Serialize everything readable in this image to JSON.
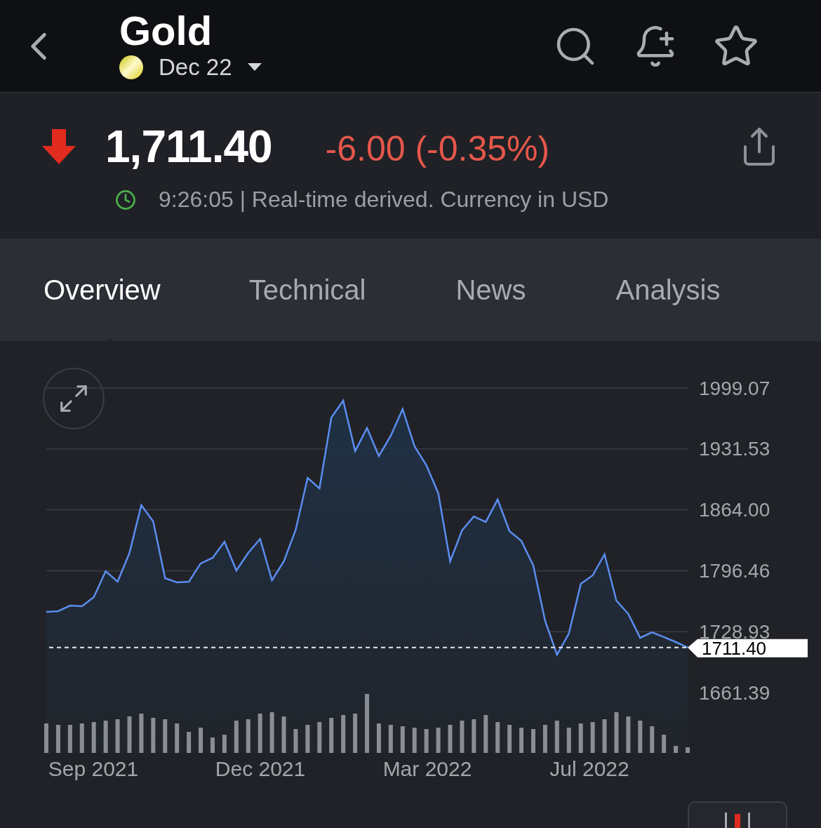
{
  "header": {
    "title": "Gold",
    "contract": "Dec 22"
  },
  "quote": {
    "price": "1,711.40",
    "change": "-6.00 (-0.35%)",
    "falling": true,
    "timestamp": "9:26:05 | Real-time derived. Currency in USD"
  },
  "tabs": [
    {
      "label": "Overview",
      "selected": true
    },
    {
      "label": "Technical",
      "selected": false
    },
    {
      "label": "News",
      "selected": false
    },
    {
      "label": "Analysis",
      "selected": false
    }
  ],
  "chart": {
    "x_labels": [
      "Sep 2021",
      "Dec 2021",
      "Mar 2022",
      "Jul 2022"
    ],
    "chart_data": {
      "type": "area",
      "grid": true,
      "ref_lines": [
        {
          "axis": "y",
          "value": 1711.4,
          "label": "1711.40",
          "color": "#e8e8e8"
        }
      ],
      "ylim": [
        1661.39,
        1999.07
      ],
      "yticks": [
        {
          "value": 1999.07,
          "label": "1999.07"
        },
        {
          "value": 1931.53,
          "label": "1931.53"
        },
        {
          "value": 1864.0,
          "label": "1864.00"
        },
        {
          "value": 1796.46,
          "label": "1796.46"
        },
        {
          "value": 1728.93,
          "label": "1728.93"
        },
        {
          "value": 1661.39,
          "label": "1661.39"
        }
      ],
      "series": [
        {
          "color": "#5b8def",
          "values": [
            1750.9,
            1751.7,
            1757.9,
            1757.1,
            1767.2,
            1796.0,
            1784.3,
            1816.2,
            1869.2,
            1851.3,
            1788.2,
            1783.6,
            1784.3,
            1804.6,
            1810.8,
            1828.7,
            1796.8,
            1816.2,
            1831.8,
            1785.9,
            1806.9,
            1841.9,
            1899.5,
            1887.8,
            1966.4,
            1985.1,
            1929.1,
            1954.7,
            1923.6,
            1946.2,
            1975.8,
            1934.5,
            1913.5,
            1882.4,
            1806.9,
            1841.1,
            1856.7,
            1850.5,
            1875.4,
            1840.4,
            1829.5,
            1802.2,
            1740.8,
            1703.4,
            1726.8,
            1782.0,
            1791.3,
            1814.7,
            1763.3,
            1748.6,
            1722.1,
            1728.3,
            1722.9,
            1717.4,
            1711.4
          ]
        }
      ]
    }
  }
}
